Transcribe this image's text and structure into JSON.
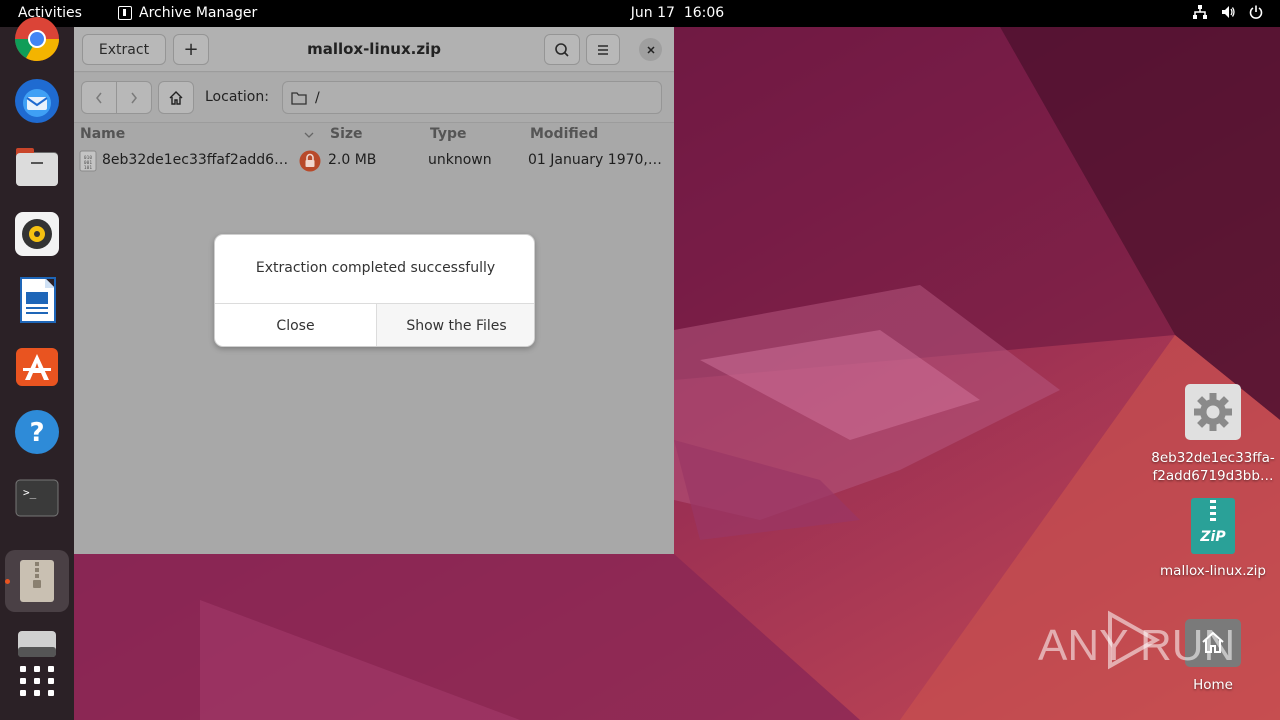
{
  "topbar": {
    "activities": "Activities",
    "app_name": "Archive Manager",
    "date": "Jun 17",
    "time": "16:06"
  },
  "dock": {
    "items": [
      "chrome-icon",
      "thunderbird-icon",
      "files-icon",
      "rhythmbox-icon",
      "writer-icon",
      "software-center-icon",
      "help-icon",
      "terminal-icon",
      "archive-manager-icon",
      "drive-icon",
      "app-grid-icon"
    ]
  },
  "window": {
    "title": "mallox-linux.zip",
    "extract_label": "Extract",
    "add_label": "+",
    "location_label": "Location:",
    "location_value": "/",
    "columns": {
      "name": "Name",
      "size": "Size",
      "type": "Type",
      "modified": "Modified"
    },
    "rows": [
      {
        "name": "8eb32de1ec33ffaf2add6…",
        "size": "2.0 MB",
        "type": "unknown",
        "modified": "01 January 1970,…"
      }
    ]
  },
  "dialog": {
    "message": "Extraction completed successfully",
    "close_label": "Close",
    "show_files_label": "Show the Files"
  },
  "desktop_icons": {
    "file": {
      "line1": "8eb32de1ec33ffa-",
      "line2": "f2add6719d3bb…"
    },
    "zip": {
      "label": "mallox-linux.zip",
      "badge": "ZiP"
    },
    "home": {
      "label": "Home"
    }
  },
  "watermark": {
    "text_left": "ANY",
    "text_right": "RUN"
  },
  "colors": {
    "accent": "#e95420",
    "topbar": "#000000",
    "dock": "#2b2126"
  }
}
